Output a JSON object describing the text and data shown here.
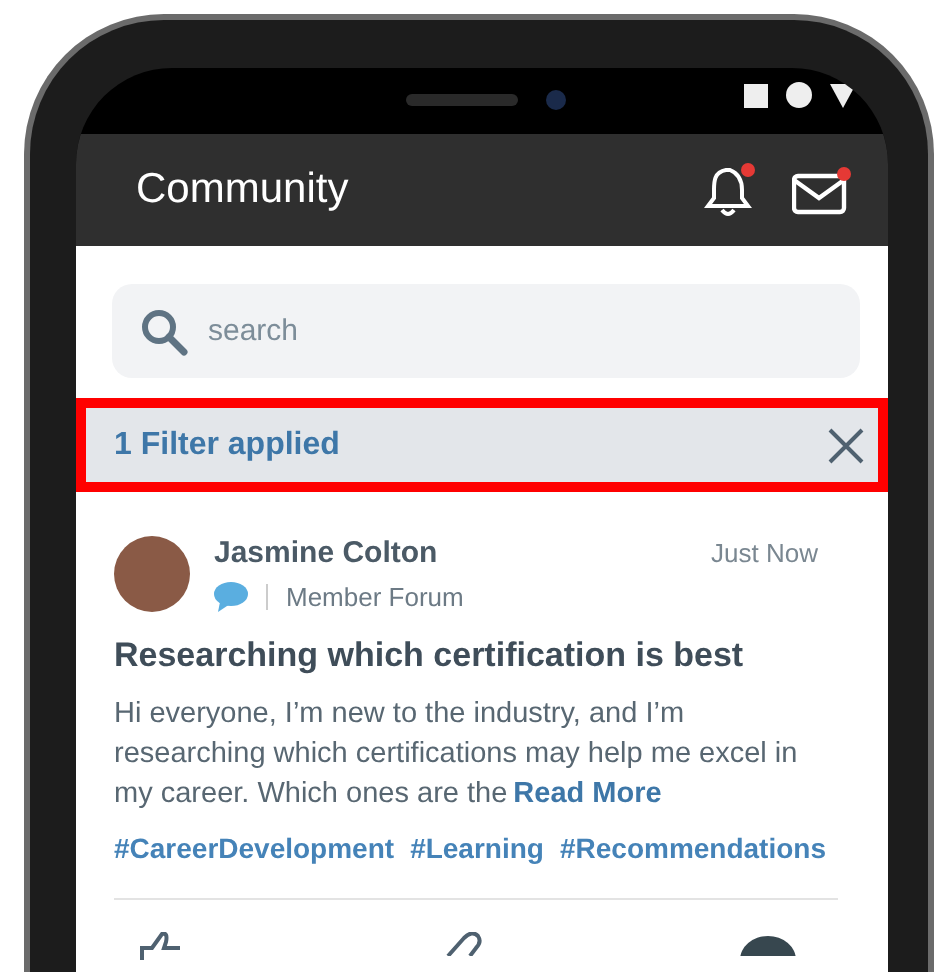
{
  "header": {
    "title": "Community",
    "notifications_unread": true,
    "messages_unread": true
  },
  "search": {
    "placeholder": "search"
  },
  "filter_bar": {
    "label": "1 Filter applied",
    "highlighted": true
  },
  "post": {
    "author": "Jasmine Colton",
    "time": "Just Now",
    "forum": "Member Forum",
    "title": "Researching which certification is best",
    "body": "Hi everyone, I’m new to the industry, and I’m researching which certifications may help me excel in my career. Which ones are the",
    "read_more": "Read More",
    "tags": [
      "#CareerDevelopment",
      "#Learning",
      "#Recommendations"
    ]
  }
}
